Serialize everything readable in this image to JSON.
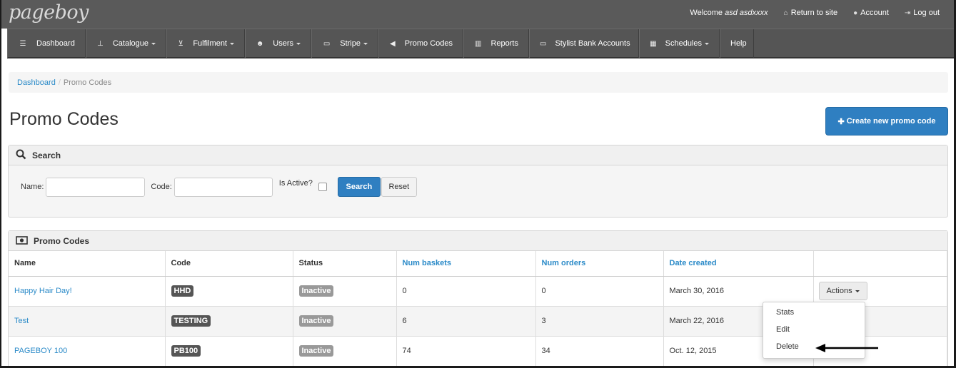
{
  "header": {
    "logo": "pageboy",
    "welcome_prefix": "Welcome",
    "username": "asd asdxxxx",
    "links": [
      {
        "label": "Return to site",
        "icon": "home-icon"
      },
      {
        "label": "Account",
        "icon": "user-icon"
      },
      {
        "label": "Log out",
        "icon": "logout-icon"
      }
    ]
  },
  "nav": [
    {
      "label": "Dashboard",
      "icon": "list-icon",
      "dropdown": false
    },
    {
      "label": "Catalogue",
      "icon": "sitemap-icon",
      "dropdown": true
    },
    {
      "label": "Fulfilment",
      "icon": "cart-icon",
      "dropdown": true
    },
    {
      "label": "Users",
      "icon": "users-icon",
      "dropdown": true
    },
    {
      "label": "Stripe",
      "icon": "card-icon",
      "dropdown": true
    },
    {
      "label": "Promo Codes",
      "icon": "bullhorn-icon",
      "dropdown": false
    },
    {
      "label": "Reports",
      "icon": "chart-icon",
      "dropdown": false
    },
    {
      "label": "Stylist Bank Accounts",
      "icon": "card-icon",
      "dropdown": false
    },
    {
      "label": "Schedules",
      "icon": "calendar-icon",
      "dropdown": true
    },
    {
      "label": "Help",
      "icon": "",
      "dropdown": false
    }
  ],
  "breadcrumb": {
    "home": "Dashboard",
    "separator": "/",
    "current": "Promo Codes"
  },
  "page": {
    "title": "Promo Codes",
    "create_button": "Create new promo code"
  },
  "search": {
    "title": "Search",
    "name_label": "Name:",
    "name_value": "",
    "code_label": "Code:",
    "code_value": "",
    "active_label": "Is Active?",
    "search_button": "Search",
    "reset_button": "Reset"
  },
  "codes": {
    "title": "Promo Codes",
    "columns": [
      "Name",
      "Code",
      "Status",
      "Num baskets",
      "Num orders",
      "Date created",
      ""
    ],
    "rows": [
      {
        "name": "Happy Hair Day!",
        "code": "HHD",
        "status": "Inactive",
        "baskets": "0",
        "orders": "0",
        "date": "March 30, 2016"
      },
      {
        "name": "Test",
        "code": "TESTING",
        "status": "Inactive",
        "baskets": "6",
        "orders": "3",
        "date": "March 22, 2016"
      },
      {
        "name": "PAGEBOY 100",
        "code": "PB100",
        "status": "Inactive",
        "baskets": "74",
        "orders": "34",
        "date": "Oct. 12, 2015"
      }
    ],
    "actions_label": "Actions",
    "actions_menu": [
      "Stats",
      "Edit",
      "Delete"
    ]
  },
  "colors": {
    "brand_blue": "#2f7fc1",
    "link_blue": "#2a8ac8",
    "nav_bg": "#555555",
    "badge_dark": "#555555",
    "badge_gray": "#999999"
  }
}
